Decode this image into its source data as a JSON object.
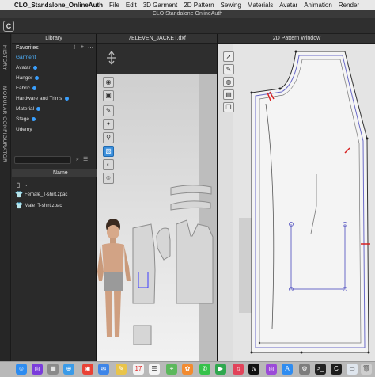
{
  "menubar": {
    "app_name": "CLO_Standalone_OnlineAuth",
    "items": [
      "File",
      "Edit",
      "3D Garment",
      "2D Pattern",
      "Sewing",
      "Materials",
      "Avatar",
      "Animation",
      "Render"
    ]
  },
  "titlebar": {
    "title": "CLO Standalone OnlineAuth"
  },
  "vertical_tabs": {
    "history": "HISTORY",
    "modular": "MODULAR CONFIGURATOR"
  },
  "library": {
    "header": "Library",
    "favorites_label": "Favorites",
    "tools": [
      "⇩",
      "+",
      "⋯"
    ],
    "items": [
      {
        "label": "Garment",
        "active": true
      },
      {
        "label": "Avatar"
      },
      {
        "label": "Hanger"
      },
      {
        "label": "Fabric"
      },
      {
        "label": "Hardware and Trims"
      },
      {
        "label": "Material"
      },
      {
        "label": "Stage"
      },
      {
        "label": "Udemy"
      }
    ],
    "column_header": "Name",
    "files": [
      {
        "label": ".."
      },
      {
        "label": "Female_T-shirt.zpac"
      },
      {
        "label": "Male_T-shirt.zpac"
      }
    ]
  },
  "window3d": {
    "title": "7ELEVEN_JACKET.dxf"
  },
  "window2d": {
    "title": "2D Pattern Window"
  },
  "colors": {
    "accent": "#3aa0ff",
    "pattern_line": "#3c3c3c",
    "selection_line": "#6a6ac8",
    "notch": "#d62020"
  },
  "dock": {
    "icons": [
      "finder-icon",
      "siri-icon",
      "launchpad-icon",
      "safari-icon",
      "chrome-icon",
      "mail-icon",
      "notes-icon",
      "calendar-icon",
      "reminders-icon",
      "maps-icon",
      "photos-icon",
      "messages-icon",
      "facetime-icon",
      "music-icon",
      "appletv-icon",
      "podcasts-icon",
      "appstore-icon",
      "settings-icon",
      "terminal-icon",
      "clo-icon",
      "preview-icon",
      "trash-icon"
    ]
  }
}
